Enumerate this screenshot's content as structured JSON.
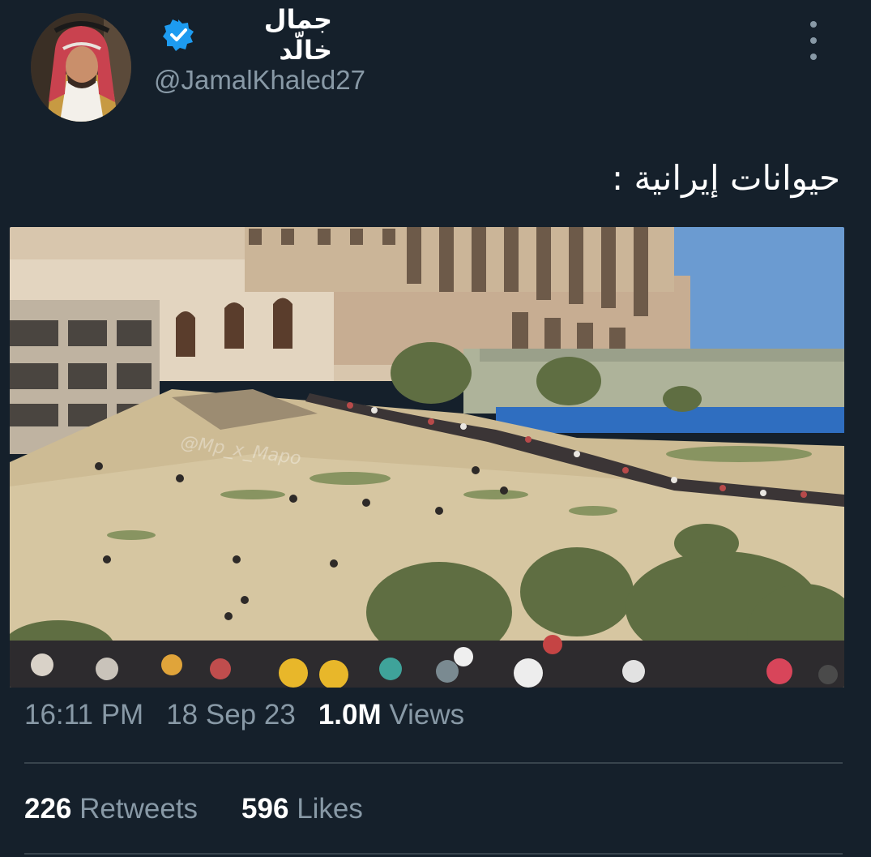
{
  "author": {
    "display_name": "جمال خالّد",
    "handle": "@JamalKhaled27",
    "avatar_icon": "person-in-keffiyeh-avatar",
    "verified_icon": "verified-badge-icon",
    "verified_color": "#1d9bf0"
  },
  "more_icon": "more-options-icon",
  "tweet": {
    "text": "حيوانات إيرانية :"
  },
  "media": {
    "watermark": "@Mp_x_Mapo"
  },
  "meta": {
    "time": "16:11 PM",
    "date": "18 Sep 23",
    "views_count": "1.0M",
    "views_label": "Views"
  },
  "stats": {
    "retweets_count": "226",
    "retweets_label": "Retweets",
    "likes_count": "596",
    "likes_label": "Likes"
  },
  "colors": {
    "background": "#15202b",
    "secondary_text": "#8899a6",
    "divider": "#38444d"
  }
}
